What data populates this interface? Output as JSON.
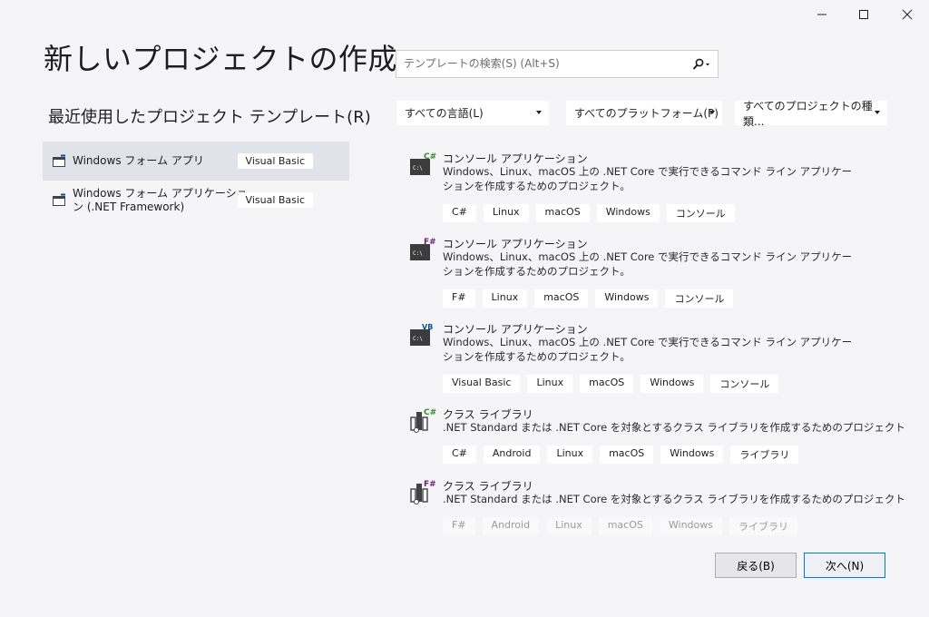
{
  "window": {
    "controls": {
      "minimize": "—",
      "maximize": "☐",
      "close": "✕"
    }
  },
  "page_title": "新しいプロジェクトの作成",
  "recent": {
    "heading": "最近使用したプロジェクト テンプレート(R)",
    "items": [
      {
        "name": "Windows フォーム アプリ",
        "badge": "Visual Basic",
        "selected": true,
        "icon": "window-form-icon"
      },
      {
        "name": "Windows フォーム アプリケーション (.NET Framework)",
        "badge": "Visual Basic",
        "selected": false,
        "icon": "window-form-icon"
      }
    ]
  },
  "search": {
    "placeholder": "テンプレートの検索(S) (Alt+S)",
    "value": "",
    "icon": "search-icon"
  },
  "filters": {
    "language": "すべての言語(L)",
    "platform": "すべてのプラットフォーム(P)",
    "project_type": "すべてのプロジェクトの種類..."
  },
  "templates": [
    {
      "title": "コンソール アプリケーション",
      "desc": "Windows、Linux、macOS 上の .NET Core で実行できるコマンド ライン アプリケーションを作成するためのプロジェクト。",
      "lang_badge": "C#",
      "badge_color": "#388a34",
      "icon": "console-app-icon",
      "tags": [
        "C#",
        "Linux",
        "macOS",
        "Windows",
        "コンソール"
      ]
    },
    {
      "title": "コンソール アプリケーション",
      "desc": "Windows、Linux、macOS 上の .NET Core で実行できるコマンド ライン アプリケーションを作成するためのプロジェクト。",
      "lang_badge": "F#",
      "badge_color": "#68217a",
      "icon": "console-app-icon",
      "tags": [
        "F#",
        "Linux",
        "macOS",
        "Windows",
        "コンソール"
      ]
    },
    {
      "title": "コンソール アプリケーション",
      "desc": "Windows、Linux、macOS 上の .NET Core で実行できるコマンド ライン アプリケーションを作成するためのプロジェクト。",
      "lang_badge": "VB",
      "badge_color": "#00539c",
      "icon": "console-app-icon",
      "tags": [
        "Visual Basic",
        "Linux",
        "macOS",
        "Windows",
        "コンソール"
      ]
    },
    {
      "title": "クラス ライブラリ",
      "desc": ".NET Standard または .NET Core を対象とするクラス ライブラリを作成するためのプロジェクト",
      "lang_badge": "C#",
      "badge_color": "#388a34",
      "icon": "class-library-icon",
      "tags": [
        "C#",
        "Android",
        "Linux",
        "macOS",
        "Windows",
        "ライブラリ"
      ]
    },
    {
      "title": "クラス ライブラリ",
      "desc": ".NET Standard または .NET Core を対象とするクラス ライブラリを作成するためのプロジェクト",
      "lang_badge": "F#",
      "badge_color": "#68217a",
      "icon": "class-library-icon",
      "tags": [
        "F#",
        "Android",
        "Linux",
        "macOS",
        "Windows",
        "ライブラリ"
      ]
    }
  ],
  "buttons": {
    "back": "戻る(B)",
    "next": "次へ(N)"
  }
}
